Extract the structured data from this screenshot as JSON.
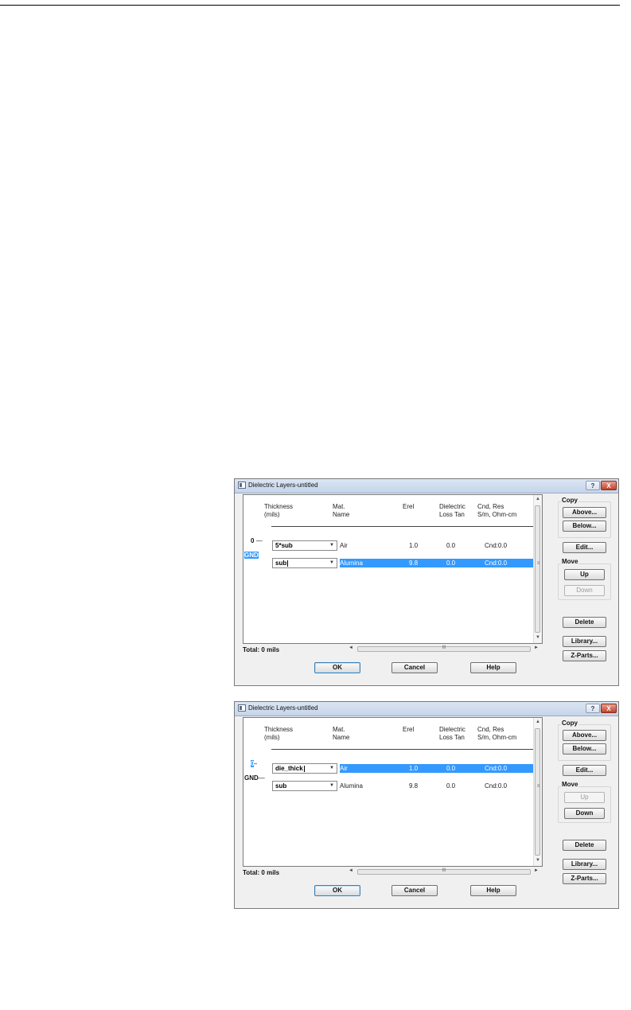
{
  "dialogs": [
    {
      "title": "Dielectric Layers-untitled",
      "title_help": "?",
      "title_close": "X",
      "headers": {
        "thickness": [
          "Thickness",
          "(mils)"
        ],
        "mat": [
          "Mat.",
          "Name"
        ],
        "erel": [
          "Erel"
        ],
        "loss": [
          "Dielectric",
          "Loss Tan"
        ],
        "cnd": [
          "Cnd, Res",
          "S/m, Ohm-cm"
        ]
      },
      "interface_labels": [
        {
          "text": "0",
          "highlighted": false
        },
        {
          "text": "GND",
          "highlighted": true
        }
      ],
      "dashes": [
        "—",
        "—"
      ],
      "layers": [
        {
          "thickness": "5*sub",
          "editing": false,
          "mat": "Air",
          "erel": "1.0",
          "loss": "0.0",
          "cnd": "Cnd:0.0",
          "selected": false
        },
        {
          "thickness": "sub",
          "editing": true,
          "mat": "Alumina",
          "erel": "9.8",
          "loss": "0.0",
          "cnd": "Cnd:0.0",
          "selected": true
        }
      ],
      "total": "Total: 0 mils",
      "copy_label": "Copy",
      "move_label": "Move",
      "buttons": {
        "above": "Above...",
        "below": "Below...",
        "edit": "Edit...",
        "up": "Up",
        "down": "Down",
        "delete": "Delete",
        "library": "Library...",
        "zparts": "Z-Parts...",
        "ok": "OK",
        "cancel": "Cancel",
        "help": "Help"
      },
      "up_enabled": true,
      "down_enabled": false,
      "scroll_glyphs": {
        "up": "▲",
        "down": "▼",
        "left": "◄",
        "right": "►",
        "grip_v": "≡",
        "grip_h": "III"
      }
    },
    {
      "title": "Dielectric Layers-untitled",
      "title_help": "?",
      "title_close": "X",
      "headers": {
        "thickness": [
          "Thickness",
          "(mils)"
        ],
        "mat": [
          "Mat.",
          "Name"
        ],
        "erel": [
          "Erel"
        ],
        "loss": [
          "Dielectric",
          "Loss Tan"
        ],
        "cnd": [
          "Cnd, Res",
          "S/m, Ohm-cm"
        ]
      },
      "interface_labels": [
        {
          "text": "0",
          "highlighted": true
        },
        {
          "text": "GND",
          "highlighted": false
        }
      ],
      "dashes": [
        "—",
        "—"
      ],
      "layers": [
        {
          "thickness": "die_thick",
          "editing": true,
          "mat": "Air",
          "erel": "1.0",
          "loss": "0.0",
          "cnd": "Cnd:0.0",
          "selected": true
        },
        {
          "thickness": "sub",
          "editing": false,
          "mat": "Alumina",
          "erel": "9.8",
          "loss": "0.0",
          "cnd": "Cnd:0.0",
          "selected": false
        }
      ],
      "total": "Total: 0 mils",
      "copy_label": "Copy",
      "move_label": "Move",
      "buttons": {
        "above": "Above...",
        "below": "Below...",
        "edit": "Edit...",
        "up": "Up",
        "down": "Down",
        "delete": "Delete",
        "library": "Library...",
        "zparts": "Z-Parts...",
        "ok": "OK",
        "cancel": "Cancel",
        "help": "Help"
      },
      "up_enabled": false,
      "down_enabled": true,
      "scroll_glyphs": {
        "up": "▲",
        "down": "▼",
        "left": "◄",
        "right": "►",
        "grip_v": "≡",
        "grip_h": "III"
      }
    }
  ]
}
